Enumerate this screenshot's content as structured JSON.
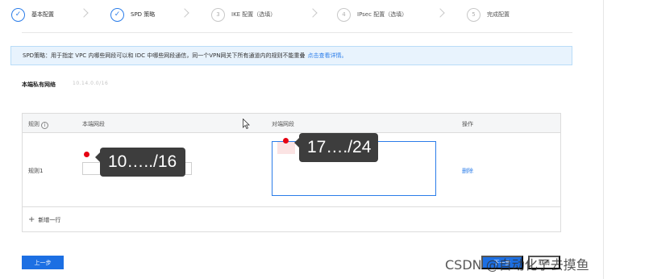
{
  "steps": [
    {
      "index": "✓",
      "label": "基本配置",
      "state": "done"
    },
    {
      "index": "✓",
      "label": "SPD 策略",
      "state": "done"
    },
    {
      "index": "3",
      "label": "IKE 配置（选填）",
      "state": "pending"
    },
    {
      "index": "4",
      "label": "IPsec 配置（选填）",
      "state": "pending"
    },
    {
      "index": "5",
      "label": "完成配置",
      "state": "pending"
    }
  ],
  "info": {
    "text": "SPD策略：用于指定 VPC 内哪些网段可以和 IDC 中哪些网段通信，同一个VPN网关下所有通道内的规则不能重叠",
    "link": "点击查看详情。"
  },
  "local_network": {
    "label": "本端私有网络",
    "value": "10.14.0.0/16"
  },
  "table": {
    "headers": {
      "rule": "规则",
      "local": "本端网段",
      "peer": "对端网段",
      "action": "操作"
    },
    "rows": [
      {
        "name": "规则1",
        "delete": "删除"
      }
    ],
    "add_row": "新增一行"
  },
  "tooltips": {
    "local": "10…../16",
    "peer": "17…./24"
  },
  "footer": {
    "prev": "上一步",
    "next": "下一步",
    "cancel": "取消"
  },
  "watermark": "CSDN @自动化了去摸鱼",
  "colors": {
    "primary": "#1c6fe3",
    "link": "#2b7de9",
    "banner_bg": "#e8f3fd",
    "marker": "#e60012",
    "tooltip_bg": "#3d3d3d"
  }
}
